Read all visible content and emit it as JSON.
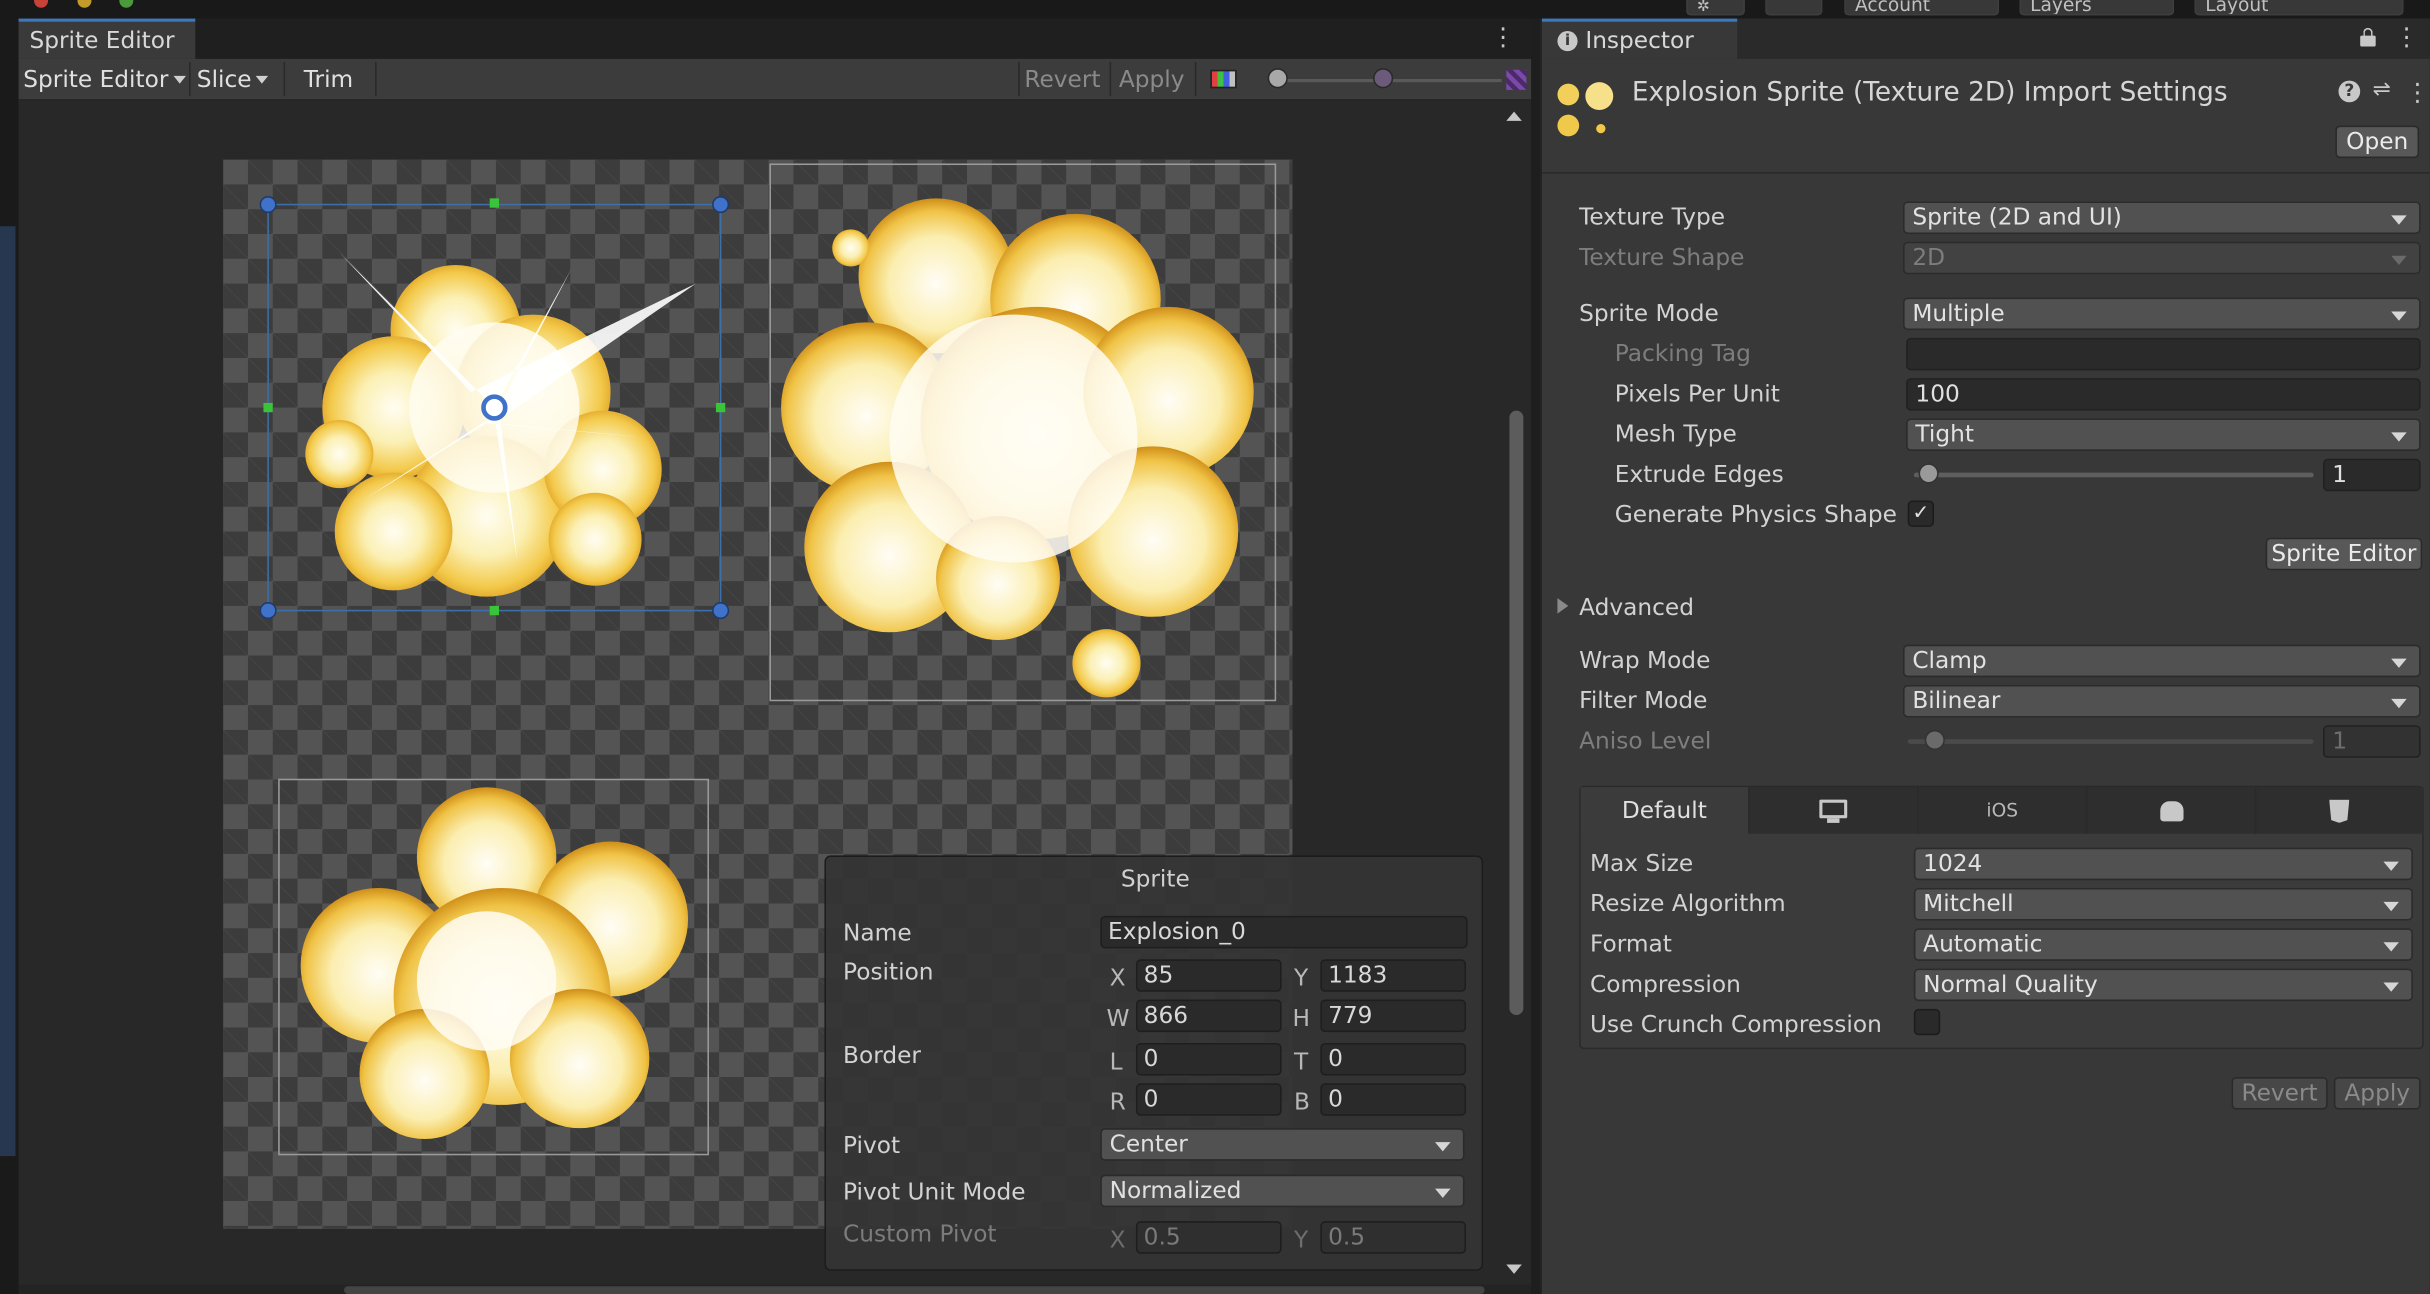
{
  "top_bar": {
    "account_label": "Account",
    "layers_label": "Layers",
    "layout_label": "Layout"
  },
  "sprite_editor": {
    "tab_title": "Sprite Editor",
    "toolbar": {
      "mode_label": "Sprite Editor",
      "slice_label": "Slice",
      "trim_label": "Trim",
      "revert_label": "Revert",
      "apply_label": "Apply"
    },
    "sprite_panel": {
      "header": "Sprite",
      "name_label": "Name",
      "name_value": "Explosion_0",
      "position_label": "Position",
      "x_label": "X",
      "x_value": "85",
      "y_label": "Y",
      "y_value": "1183",
      "w_label": "W",
      "w_value": "866",
      "h_label": "H",
      "h_value": "779",
      "border_label": "Border",
      "l_label": "L",
      "l_value": "0",
      "t_label": "T",
      "t_value": "0",
      "r_label": "R",
      "r_value": "0",
      "b_label": "B",
      "b_value": "0",
      "pivot_label": "Pivot",
      "pivot_value": "Center",
      "pivot_unit_mode_label": "Pivot Unit Mode",
      "pivot_unit_mode_value": "Normalized",
      "custom_pivot_label": "Custom Pivot",
      "custom_pivot_x_label": "X",
      "custom_pivot_x": "0.5",
      "custom_pivot_y_label": "Y",
      "custom_pivot_y": "0.5"
    }
  },
  "inspector": {
    "tab_title": "Inspector",
    "header_title": "Explosion Sprite (Texture 2D) Import Settings",
    "open_button": "Open",
    "texture_type_label": "Texture Type",
    "texture_type_value": "Sprite (2D and UI)",
    "texture_shape_label": "Texture Shape",
    "texture_shape_value": "2D",
    "sprite_mode_label": "Sprite Mode",
    "sprite_mode_value": "Multiple",
    "packing_tag_label": "Packing Tag",
    "packing_tag_value": "",
    "pixels_per_unit_label": "Pixels Per Unit",
    "pixels_per_unit_value": "100",
    "mesh_type_label": "Mesh Type",
    "mesh_type_value": "Tight",
    "extrude_edges_label": "Extrude Edges",
    "extrude_edges_value": "1",
    "generate_physics_shape_label": "Generate Physics Shape",
    "generate_physics_shape_checked": true,
    "sprite_editor_button": "Sprite Editor",
    "advanced_label": "Advanced",
    "wrap_mode_label": "Wrap Mode",
    "wrap_mode_value": "Clamp",
    "filter_mode_label": "Filter Mode",
    "filter_mode_value": "Bilinear",
    "aniso_level_label": "Aniso Level",
    "aniso_level_value": "1",
    "platform_tabs": {
      "default_label": "Default",
      "ios_label": "iOS",
      "icons": [
        "monitor-icon",
        "android-icon",
        "html5-icon"
      ]
    },
    "max_size_label": "Max Size",
    "max_size_value": "1024",
    "resize_algorithm_label": "Resize Algorithm",
    "resize_algorithm_value": "Mitchell",
    "format_label": "Format",
    "format_value": "Automatic",
    "compression_label": "Compression",
    "compression_value": "Normal Quality",
    "crunch_label": "Use Crunch Compression",
    "crunch_checked": false,
    "revert_label": "Revert",
    "apply_label": "Apply"
  }
}
